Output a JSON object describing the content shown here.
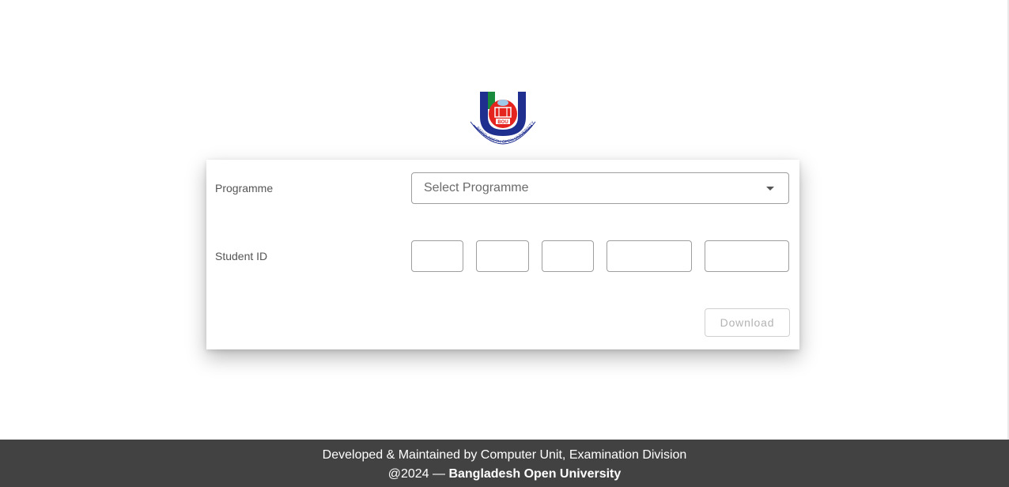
{
  "logo": {
    "icon": "bangladesh-open-university-logo",
    "emblem_text": "BOU",
    "ring_text": "BANGLADESH OPEN UNIVERSITY"
  },
  "form": {
    "programme_label": "Programme",
    "programme_placeholder": "Select Programme",
    "student_id_label": "Student ID",
    "student_id_parts": [
      "",
      "",
      "",
      "",
      ""
    ],
    "download_label": "Download"
  },
  "footer": {
    "line1": "Developed & Maintained by Computer Unit, Examination Division",
    "copyright_prefix": "@2024 — ",
    "organization": "Bangladesh Open University"
  },
  "colors": {
    "footer_bg": "#424242",
    "logo_blue": "#1f2f8f",
    "logo_red": "#e52420",
    "logo_green": "#1a8a3c",
    "disabled_text": "#b3b3b3"
  }
}
